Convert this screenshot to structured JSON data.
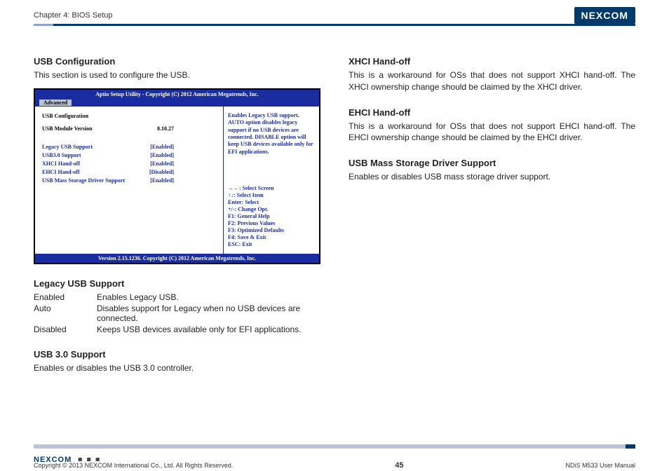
{
  "header": {
    "chapter": "Chapter 4: BIOS Setup",
    "brand": "NEXCOM"
  },
  "left": {
    "title": "USB Configuration",
    "intro": "This section is used to configure the USB.",
    "bios": {
      "title": "Aptio Setup Utility - Copyright (C) 2012 American Megatrends, Inc.",
      "tab": "Advanced",
      "cfg_label": "USB Configuration",
      "version_label": "USB Module Version",
      "version_value": "8.10.27",
      "rows": [
        {
          "k": "Legacy USB Support",
          "v": "[Enabled]"
        },
        {
          "k": "USB3.0 Support",
          "v": "[Enabled]"
        },
        {
          "k": "XHCI Hand-off",
          "v": "[Enabled]"
        },
        {
          "k": "EHCI Hand-off",
          "v": "[Disabled]"
        },
        {
          "k": "USB Mass Storage Driver Support",
          "v": "[Enabled]"
        }
      ],
      "hint": "Enables Legacy USB support. AUTO option disables legacy support if no USB devices are connected. DISABLE option will keep USB devices available only for EFI applications.",
      "nav": [
        "→←: Select Screen",
        "↑↓: Select Item",
        "Enter: Select",
        "+/-: Change Opt.",
        "F1: General Help",
        "F2: Previous Values",
        "F3: Optimized Defaults",
        "F4: Save & Exit",
        "ESC: Exit"
      ],
      "footer": "Version 2.15.1236. Copyright (C) 2012 American Megatrends, Inc."
    },
    "legacy": {
      "title": "Legacy USB Support",
      "rows": [
        {
          "k": "Enabled",
          "v": "Enables Legacy USB."
        },
        {
          "k": "Auto",
          "v": "Disables support for Legacy when no USB devices are connected."
        },
        {
          "k": "Disabled",
          "v": "Keeps USB devices available only for EFI applications."
        }
      ]
    },
    "usb3": {
      "title": "USB 3.0 Support",
      "text": "Enables or disables the USB 3.0 controller."
    }
  },
  "right": {
    "xhci": {
      "title": "XHCI Hand-off",
      "text": "This is a workaround for OSs that does not support XHCI hand-off. The XHCI ownership change should be claimed by the XHCI driver."
    },
    "ehci": {
      "title": "EHCI Hand-off",
      "text": "This is a workaround for OSs that does not support EHCI hand-off. The EHCI ownership change should be claimed by the EHCI driver."
    },
    "mass": {
      "title": "USB Mass Storage Driver Support",
      "text": "Enables or disables USB mass storage driver support."
    }
  },
  "footer": {
    "copyright": "Copyright © 2013 NEXCOM International Co., Ltd. All Rights Reserved.",
    "page": "45",
    "doc": "NDiS M533 User Manual",
    "brand": "NEXCOM"
  }
}
